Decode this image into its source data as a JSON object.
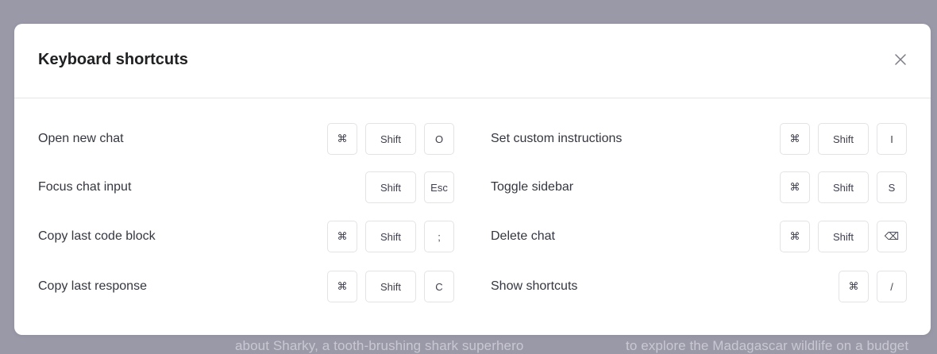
{
  "backdrop": {
    "text_left": "about Sharky, a tooth-brushing shark superhero",
    "text_right": "to explore the Madagascar wildlife on a budget"
  },
  "modal": {
    "title": "Keyboard shortcuts",
    "close_icon": "close-icon"
  },
  "shortcuts_left": [
    {
      "label": "Open new chat",
      "keys": [
        "⌘",
        "Shift",
        "O"
      ]
    },
    {
      "label": "Focus chat input",
      "keys": [
        "Shift",
        "Esc"
      ]
    },
    {
      "label": "Copy last code block",
      "keys": [
        "⌘",
        "Shift",
        ";"
      ]
    },
    {
      "label": "Copy last response",
      "keys": [
        "⌘",
        "Shift",
        "C"
      ]
    }
  ],
  "shortcuts_right": [
    {
      "label": "Set custom instructions",
      "keys": [
        "⌘",
        "Shift",
        "I"
      ]
    },
    {
      "label": "Toggle sidebar",
      "keys": [
        "⌘",
        "Shift",
        "S"
      ]
    },
    {
      "label": "Delete chat",
      "keys": [
        "⌘",
        "Shift",
        "⌫"
      ]
    },
    {
      "label": "Show shortcuts",
      "keys": [
        "⌘",
        "/"
      ]
    }
  ]
}
